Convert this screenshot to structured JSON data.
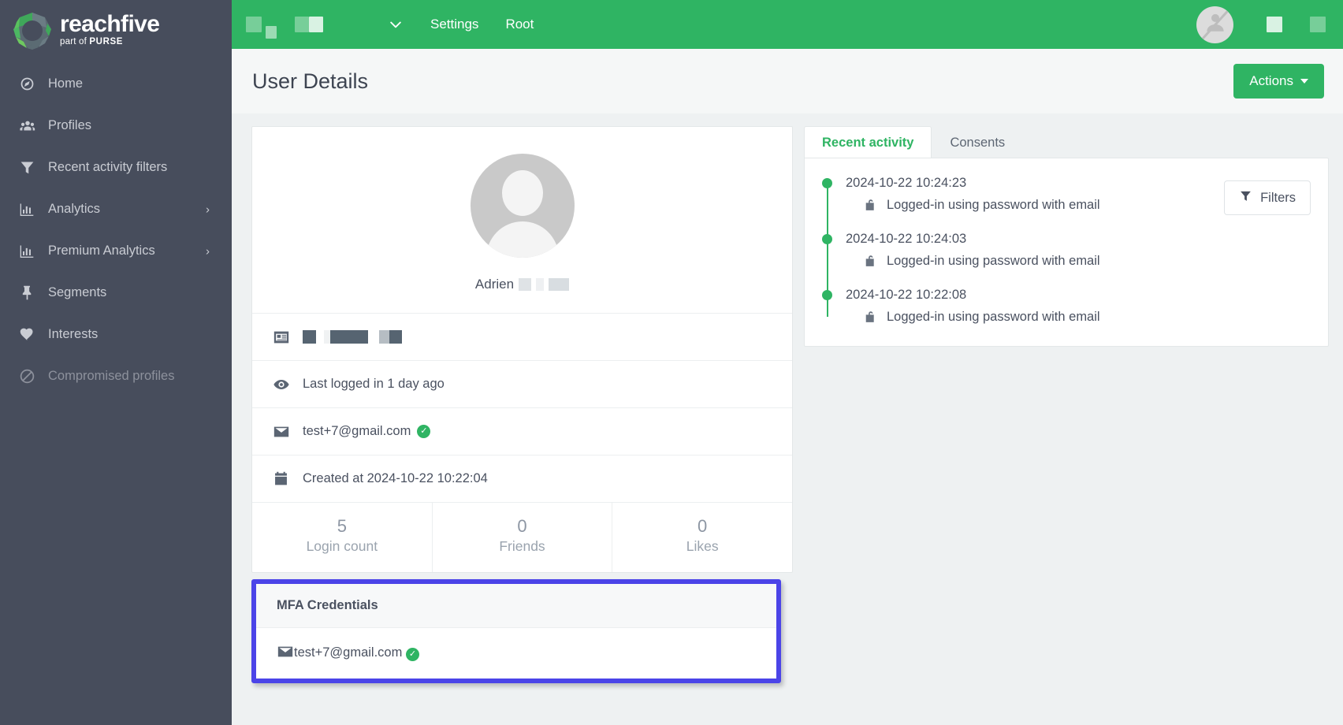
{
  "brand": {
    "name": "reachfive",
    "tagline_prefix": "part of ",
    "tagline_brand": "PURSE",
    "logo_icon": "reachfive-polygon-logo"
  },
  "sidebar": {
    "items": [
      {
        "label": "Home",
        "icon": "gauge-icon",
        "has_submenu": false,
        "disabled": false
      },
      {
        "label": "Profiles",
        "icon": "people-icon",
        "has_submenu": false,
        "disabled": false
      },
      {
        "label": "Recent activity filters",
        "icon": "funnel-icon",
        "has_submenu": false,
        "disabled": false
      },
      {
        "label": "Analytics",
        "icon": "bar-chart-icon",
        "has_submenu": true,
        "disabled": false
      },
      {
        "label": "Premium Analytics",
        "icon": "bar-chart-icon",
        "has_submenu": true,
        "disabled": false
      },
      {
        "label": "Segments",
        "icon": "pin-icon",
        "has_submenu": false,
        "disabled": false
      },
      {
        "label": "Interests",
        "icon": "heart-icon",
        "has_submenu": false,
        "disabled": false
      },
      {
        "label": "Compromised profiles",
        "icon": "no-entry-icon",
        "has_submenu": false,
        "disabled": true
      }
    ],
    "chevron": "›"
  },
  "topbar": {
    "dropdown_icon": "chevron-down-icon",
    "settings_label": "Settings",
    "root_label": "Root",
    "avatar_icon": "user-blocked-avatar-icon",
    "background": "#2fb463"
  },
  "page": {
    "title": "User Details",
    "actions_label": "Actions"
  },
  "profile": {
    "avatar_icon": "default-user-avatar-icon",
    "name": "Adrien",
    "identity_icon": "id-card-icon",
    "last_login_icon": "eye-icon",
    "last_login_text": "Last logged in 1 day ago",
    "email_icon": "envelope-icon",
    "email": "test+7@gmail.com",
    "email_verified_icon": "verified-check-icon",
    "created_icon": "calendar-icon",
    "created_text": "Created at 2024-10-22 10:22:04",
    "stats": [
      {
        "value": "5",
        "label": "Login count"
      },
      {
        "value": "0",
        "label": "Friends"
      },
      {
        "value": "0",
        "label": "Likes"
      }
    ]
  },
  "mfa": {
    "title": "MFA Credentials",
    "highlight_color": "#4b44e8",
    "credentials": [
      {
        "icon": "envelope-icon",
        "value": "test+7@gmail.com",
        "verified_icon": "verified-check-icon"
      }
    ]
  },
  "activity": {
    "tabs": [
      {
        "label": "Recent activity",
        "active": true
      },
      {
        "label": "Consents",
        "active": false
      }
    ],
    "filters_label": "Filters",
    "filters_icon": "funnel-icon",
    "accent_color": "#2fb463",
    "entries": [
      {
        "timestamp": "2024-10-22 10:24:23",
        "icon": "unlock-icon",
        "description": "Logged-in using password with email"
      },
      {
        "timestamp": "2024-10-22 10:24:03",
        "icon": "unlock-icon",
        "description": "Logged-in using password with email"
      },
      {
        "timestamp": "2024-10-22 10:22:08",
        "icon": "unlock-icon",
        "description": "Logged-in using password with email"
      }
    ]
  }
}
